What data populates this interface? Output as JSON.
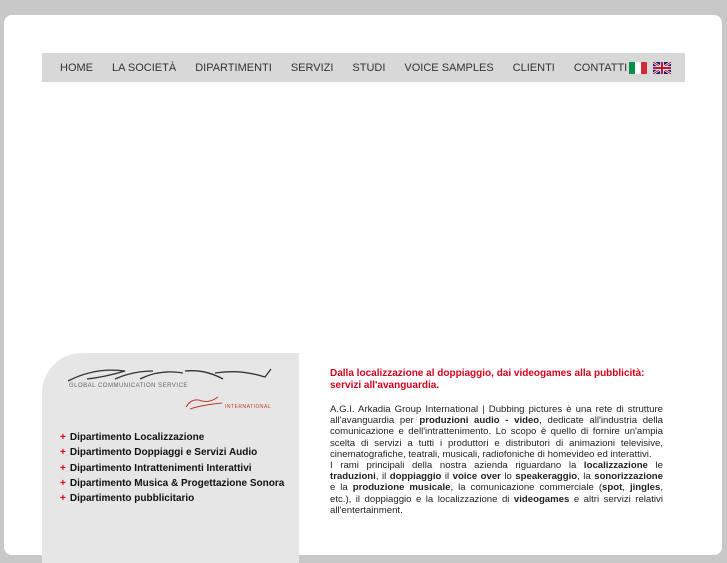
{
  "nav": {
    "items": [
      "HOME",
      "LA SOCIETÀ",
      "DIPARTIMENTI",
      "SERVIZI",
      "STUDI",
      "VOICE SAMPLES",
      "CLIENTI",
      "CONTATTI"
    ],
    "flags": [
      {
        "icon": "italy-flag-icon"
      },
      {
        "icon": "uk-flag-icon"
      }
    ]
  },
  "sidebar": {
    "logo": "ARKADIA",
    "tagline": "GLOBAL COMMUNICATION SERVICE",
    "group_logo_script": "Group",
    "group_logo_text": "INTERNATIONAL",
    "departments": [
      "Dipartimento Localizzazione",
      "Dipartimento Doppiaggi e Servizi Audio",
      "Dipartimento Intrattenimenti Interattivi",
      "Dipartimento Musica & Progettazione Sonora",
      "Dipartimento pubblicitario"
    ]
  },
  "content": {
    "headline": "Dalla localizzazione al doppiaggio, dai videogames alla pubblicità: servizi all'avanguardia.",
    "p1_a": "A.G.I. Arkadia Group International | Dubbing pictures è una rete di strutture all'avanguardia per ",
    "p1_b1": "produzioni audio - video",
    "p1_c": ", dedicate all'industria della comunicazione e dell'intrattenimento. Lo scopo è quello di fornire un'ampia scelta di servizi a tutti i produttori e distributori di animazioni televisive, cinematografiche, teatrali, musicali, radiofoniche di homevideo ed interattivi.",
    "p2_a": "I rami principali della nostra azienda riguardano la ",
    "p2_b1": "localizzazione",
    "p2_c": " le ",
    "p2_b2": "traduzioni",
    "p2_d": ", il ",
    "p2_b3": "doppiaggio",
    "p2_e": " il ",
    "p2_b4": "voice over",
    "p2_f": " lo ",
    "p2_b5": "speakeraggio",
    "p2_g": ", la ",
    "p2_b6": "sonorizzazione",
    "p2_h": " e la ",
    "p2_b7": "produzione musicale",
    "p2_i": ", la comunicazione commerciale (",
    "p2_b8": "spot",
    "p2_j": ", ",
    "p2_b9": "jingles",
    "p2_k": ", etc.), il doppiaggio e la localizzazione di ",
    "p2_b10": "videogames",
    "p2_l": " e altri servizi relativi all'entertainment."
  }
}
